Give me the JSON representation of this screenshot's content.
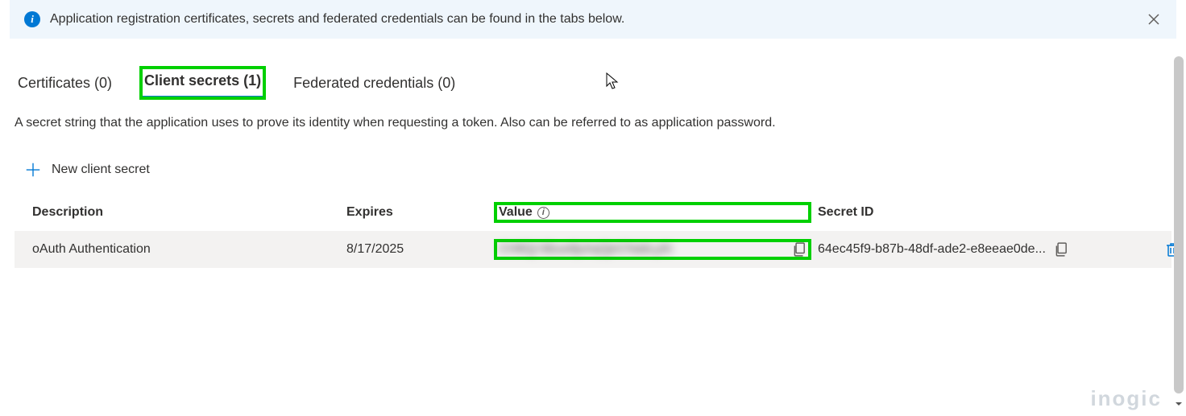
{
  "banner": {
    "message": "Application registration certificates, secrets and federated credentials can be found in the tabs below."
  },
  "tabs": {
    "certificates": "Certificates (0)",
    "client_secrets": "Client secrets (1)",
    "federated": "Federated credentials (0)"
  },
  "description": "A secret string that the application uses to prove its identity when requesting a token. Also can be referred to as application password.",
  "actions": {
    "new_secret": "New client secret"
  },
  "table": {
    "headers": {
      "description": "Description",
      "expires": "Expires",
      "value": "Value",
      "secret_id": "Secret ID"
    },
    "rows": [
      {
        "description": "oAuth Authentication",
        "expires": "8/17/2025",
        "value": "CH8Qj hBuw8juhqQjnCNabLpN",
        "secret_id": "64ec45f9-b87b-48df-ade2-e8eeae0de..."
      }
    ]
  },
  "watermark": "inogic"
}
